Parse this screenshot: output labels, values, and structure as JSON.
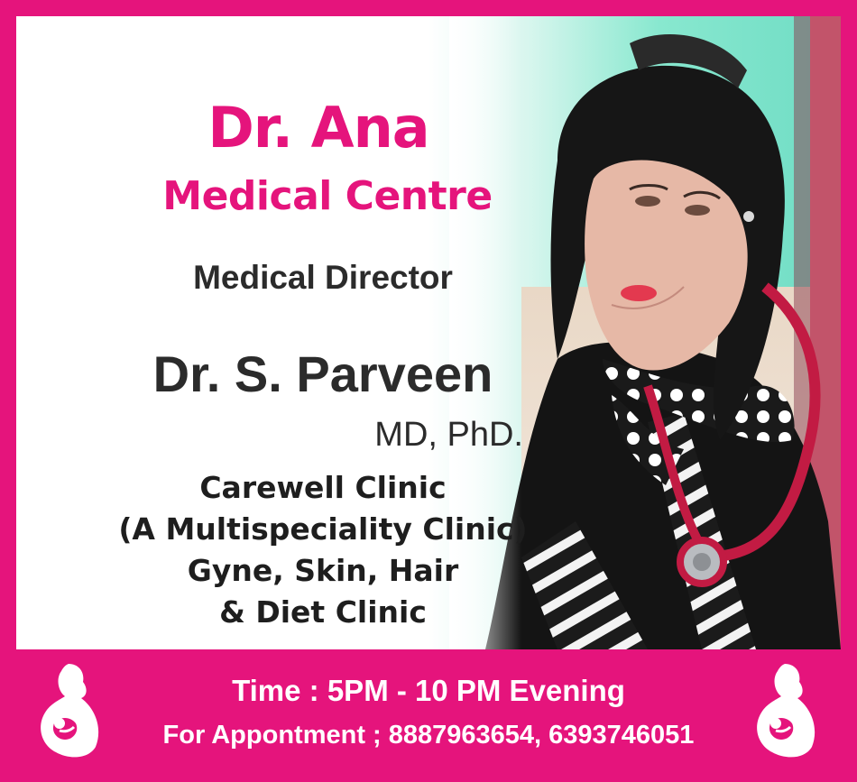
{
  "clinic_name": {
    "line1": "Dr. Ana",
    "line2": "Medical Centre"
  },
  "role": "Medical Director",
  "doctor": {
    "name": "Dr. S. Parveen",
    "degree": "MD, PhD."
  },
  "clinic_info": {
    "line1": "Carewell Clinic",
    "line2": "(A Multispeciality Clinic)",
    "line3": "Gyne, Skin, Hair",
    "line4": "& Diet Clinic"
  },
  "footer": {
    "time": "Time : 5PM - 10 PM Evening",
    "appointment": "For Appontment ; 8887963654, 6393746051"
  },
  "colors": {
    "brand_pink": "#e5147c",
    "text_dark": "#2b2b2b",
    "teal_bg": "#79e6cf"
  },
  "icons": {
    "logo": "mother-baby-icon"
  }
}
